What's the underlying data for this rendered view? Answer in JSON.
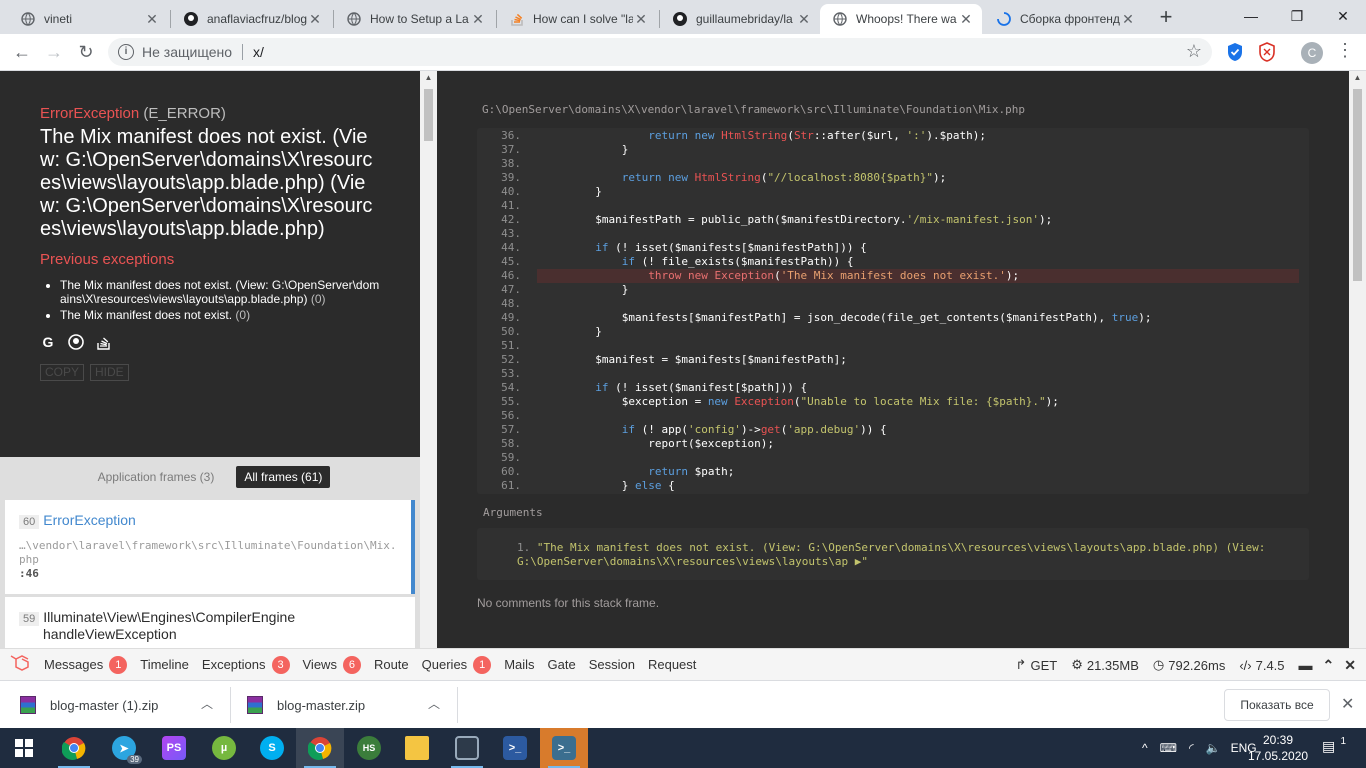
{
  "browser": {
    "tabs": [
      {
        "title": "vineti",
        "icon": "globe-icon"
      },
      {
        "title": "anaflaviacfruz/blog",
        "icon": "github-icon"
      },
      {
        "title": "How to Setup a La",
        "icon": "globe-icon"
      },
      {
        "title": "How can I solve \"la",
        "icon": "stackoverflow-icon"
      },
      {
        "title": "guillaumebriday/la",
        "icon": "github-icon"
      },
      {
        "title": "Whoops! There wa",
        "icon": "globe-icon",
        "active": true
      },
      {
        "title": "Сборка фронтенд",
        "icon": "loading-icon"
      }
    ],
    "new_tab": "+",
    "window_controls": {
      "minimize": "—",
      "maximize": "❐",
      "close": "✕"
    },
    "address": {
      "security_label": "Не защищено",
      "url": "x/"
    },
    "profile_initial": "C"
  },
  "whoops": {
    "exception_class": "ErrorException",
    "exception_code": "(E_ERROR)",
    "message": "The Mix manifest does not exist. (View: G:\\OpenServer\\domains\\X\\resources\\views\\layouts\\app.blade.php) (View: G:\\OpenServer\\domains\\X\\resources\\views\\layouts\\app.blade.php)",
    "previous_title": "Previous exceptions",
    "previous": [
      {
        "text": "The Mix manifest does not exist. (View: G:\\OpenServer\\domains\\X\\resources\\views\\layouts\\app.blade.php)",
        "code": "(0)"
      },
      {
        "text": "The Mix manifest does not exist.",
        "code": "(0)"
      }
    ],
    "buttons": {
      "copy": "COPY",
      "hide": "HIDE"
    },
    "frames_filter": {
      "application": "Application frames (3)",
      "all": "All frames (61)"
    },
    "frames": [
      {
        "num": "60",
        "class": "ErrorException",
        "file": "…\\vendor\\laravel\\framework\\src\\Illuminate\\Foundation\\Mix.php",
        "line": ":46"
      },
      {
        "num": "59",
        "class": "Illuminate\\View\\Engines\\CompilerEngine",
        "method": "handleViewException"
      }
    ],
    "file_path": "G:\\OpenServer\\domains\\X\\vendor\\laravel\\framework\\src\\Illuminate\\Foundation\\Mix.php",
    "highlight_line": 46,
    "code_lines": [
      {
        "n": "36.",
        "html": "            <span class=\"kw\">return new</span> <span class=\"fn\">HtmlString</span>(<span class=\"fn\">Str</span>::after($url, <span class=\"str\">':'</span>).$path);"
      },
      {
        "n": "37.",
        "html": "        }"
      },
      {
        "n": "38.",
        "html": ""
      },
      {
        "n": "39.",
        "html": "        <span class=\"kw\">return new</span> <span class=\"fn\">HtmlString</span>(<span class=\"str\">\"//localhost:8080{$path}\"</span>);"
      },
      {
        "n": "40.",
        "html": "    }"
      },
      {
        "n": "41.",
        "html": ""
      },
      {
        "n": "42.",
        "html": "    $manifestPath = public_path($manifestDirectory.<span class=\"str\">'/mix-manifest.json'</span>);"
      },
      {
        "n": "43.",
        "html": ""
      },
      {
        "n": "44.",
        "html": "    <span class=\"kw\">if</span> (! isset($manifests[$manifestPath])) {"
      },
      {
        "n": "45.",
        "html": "        <span class=\"kw\">if</span> (! file_exists($manifestPath)) {"
      },
      {
        "n": "46.",
        "html": "            <span class=\"kw\">throw new</span> <span class=\"fn\">Exception</span>(<span class=\"str\">'The Mix manifest does not exist.'</span>);"
      },
      {
        "n": "47.",
        "html": "        }"
      },
      {
        "n": "48.",
        "html": ""
      },
      {
        "n": "49.",
        "html": "        $manifests[$manifestPath] = json_decode(file_get_contents($manifestPath), <span class=\"kw\">true</span>);"
      },
      {
        "n": "50.",
        "html": "    }"
      },
      {
        "n": "51.",
        "html": ""
      },
      {
        "n": "52.",
        "html": "    $manifest = $manifests[$manifestPath];"
      },
      {
        "n": "53.",
        "html": ""
      },
      {
        "n": "54.",
        "html": "    <span class=\"kw\">if</span> (! isset($manifest[$path])) {"
      },
      {
        "n": "55.",
        "html": "        $exception = <span class=\"kw\">new</span> <span class=\"fn\">Exception</span>(<span class=\"str\">\"Unable to locate Mix file: {$path}.\"</span>);"
      },
      {
        "n": "56.",
        "html": ""
      },
      {
        "n": "57.",
        "html": "        <span class=\"kw\">if</span> (! app(<span class=\"str\">'config'</span>)-><span class=\"fn\">get</span>(<span class=\"str\">'app.debug'</span>)) {"
      },
      {
        "n": "58.",
        "html": "            report($exception);"
      },
      {
        "n": "59.",
        "html": ""
      },
      {
        "n": "60.",
        "html": "            <span class=\"kw\">return</span> $path;"
      },
      {
        "n": "61.",
        "html": "        } <span class=\"kw\">else</span> {"
      }
    ],
    "arguments_title": "Arguments",
    "argument": "\"The Mix manifest does not exist. (View: G:\\OpenServer\\domains\\X\\resources\\views\\layouts\\app.blade.php) (View: G:\\OpenServer\\domains\\X\\resources\\views\\layouts\\ap ▶\"",
    "argument_num": "1.",
    "no_comments": "No comments for this stack frame."
  },
  "debugbar": {
    "tabs": [
      {
        "label": "Messages",
        "badge": "1"
      },
      {
        "label": "Timeline"
      },
      {
        "label": "Exceptions",
        "badge": "3"
      },
      {
        "label": "Views",
        "badge": "6"
      },
      {
        "label": "Route"
      },
      {
        "label": "Queries",
        "badge": "1"
      },
      {
        "label": "Mails"
      },
      {
        "label": "Gate"
      },
      {
        "label": "Session"
      },
      {
        "label": "Request"
      }
    ],
    "method": "GET",
    "memory": "21.35MB",
    "time": "792.26ms",
    "php_version": "7.4.5"
  },
  "downloads": {
    "items": [
      "blog-master (1).zip",
      "blog-master.zip"
    ],
    "show_all": "Показать все"
  },
  "taskbar": {
    "badge_telegram": "39",
    "lang": "ENG",
    "time": "20:39",
    "date": "17.05.2020",
    "notifications": "1"
  }
}
